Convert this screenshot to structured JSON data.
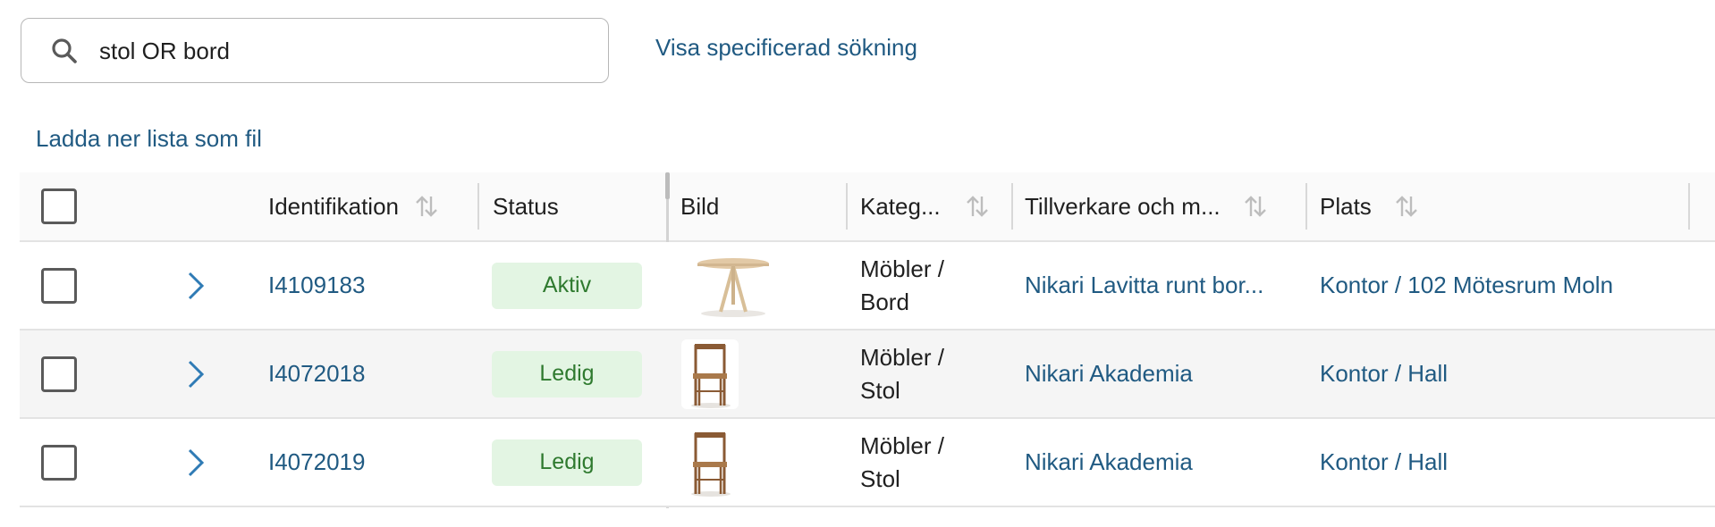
{
  "search": {
    "value": "stol OR bord",
    "icon": "search-icon"
  },
  "links": {
    "advanced_search": "Visa specificerad sökning",
    "download_list": "Ladda ner lista som fil"
  },
  "table": {
    "headers": {
      "identification": "Identifikation",
      "status": "Status",
      "image": "Bild",
      "category": "Kateg...",
      "manufacturer": "Tillverkare och m...",
      "location": "Plats"
    },
    "rows": [
      {
        "id": "I4109183",
        "status": "Aktiv",
        "image": "round-table-thumbnail",
        "category_line1": "Möbler /",
        "category_line2": "Bord",
        "manufacturer": "Nikari Lavitta runt bor...",
        "location": "Kontor / 102 Mötesrum Moln"
      },
      {
        "id": "I4072018",
        "status": "Ledig",
        "image": "chair-thumbnail",
        "category_line1": "Möbler /",
        "category_line2": "Stol",
        "manufacturer": "Nikari Akademia",
        "location": "Kontor / Hall"
      },
      {
        "id": "I4072019",
        "status": "Ledig",
        "image": "chair-thumbnail",
        "category_line1": "Möbler /",
        "category_line2": "Stol",
        "manufacturer": "Nikari Akademia",
        "location": "Kontor / Hall"
      }
    ]
  },
  "colors": {
    "link": "#205a82",
    "badge_bg": "#e3f5e3",
    "badge_text": "#2f7a2f",
    "alt_row": "#f5f5f5"
  }
}
